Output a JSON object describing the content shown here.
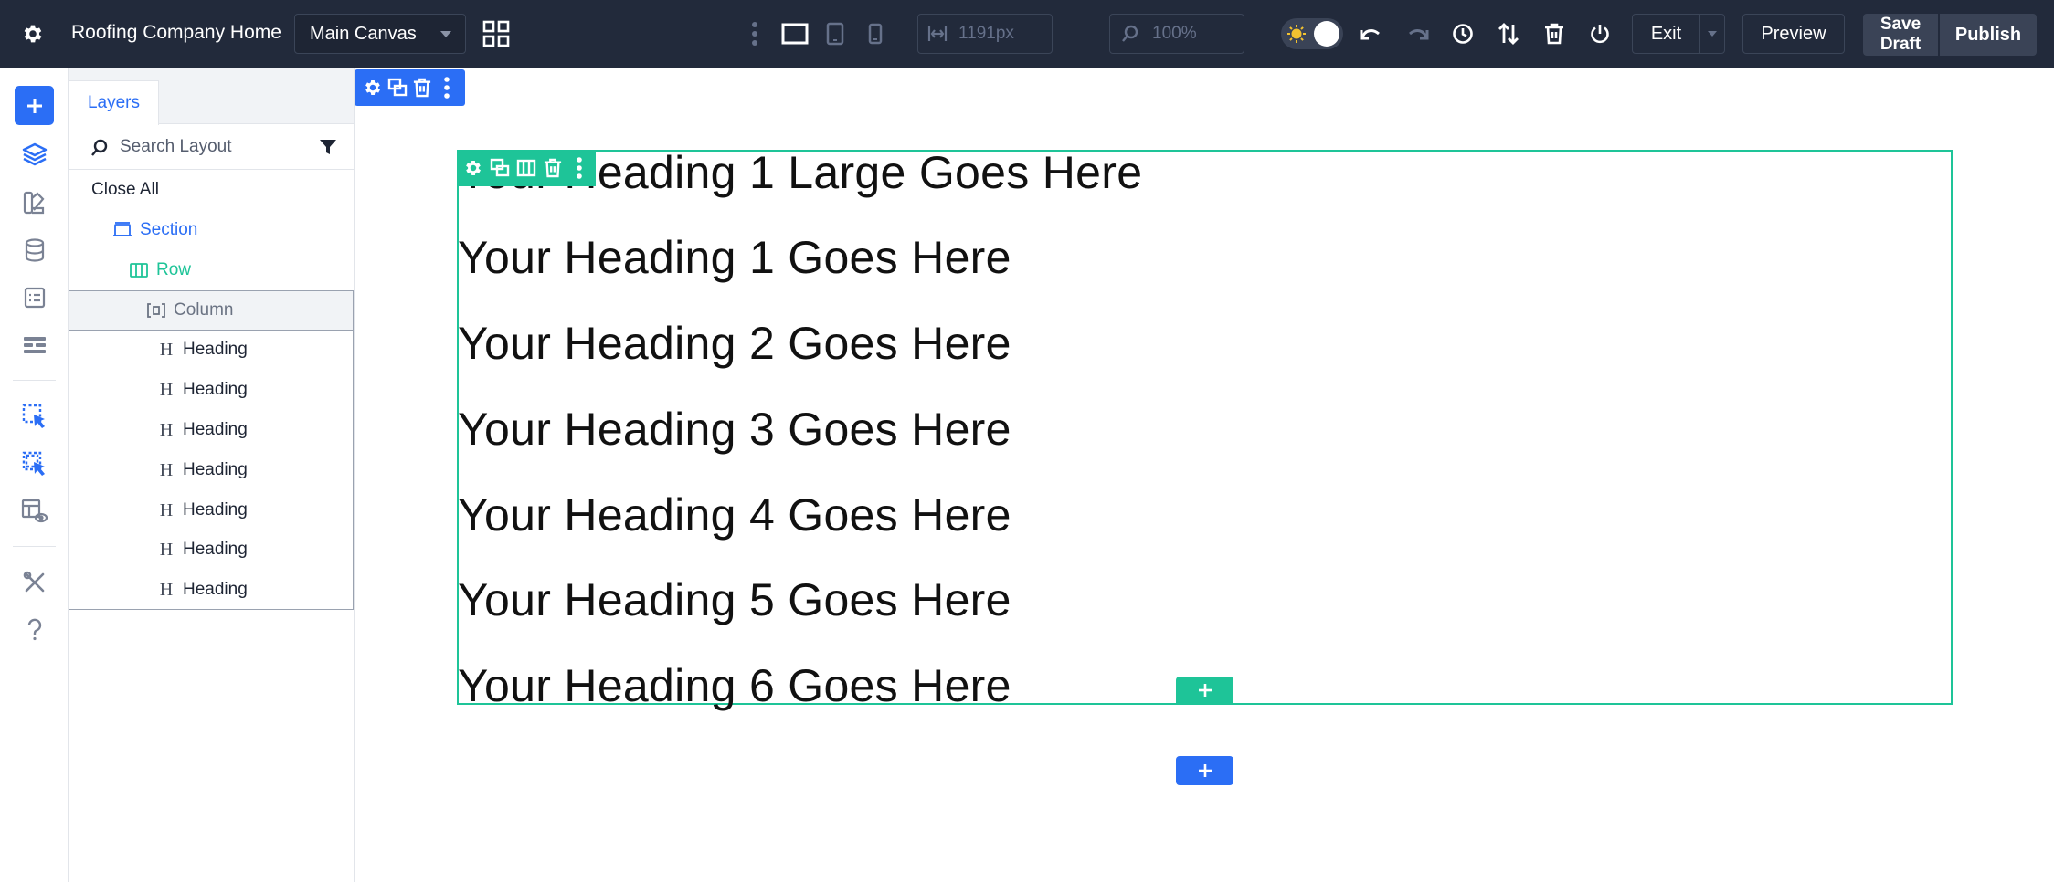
{
  "topbar": {
    "site_title": "Roofing Company Home",
    "canvas_select": "Main Canvas",
    "width_value": "1191px",
    "zoom_value": "100%",
    "exit_label": "Exit",
    "preview_label": "Preview",
    "save_draft_line1": "Save",
    "save_draft_line2": "Draft",
    "publish_label": "Publish"
  },
  "layers": {
    "tab_label": "Layers",
    "search_placeholder": "Search Layout",
    "close_all_label": "Close All",
    "section_label": "Section",
    "row_label": "Row",
    "column_label": "Column",
    "headings": [
      "Heading",
      "Heading",
      "Heading",
      "Heading",
      "Heading",
      "Heading",
      "Heading"
    ]
  },
  "canvas": {
    "headings": [
      "Your Heading 1 Large Goes Here",
      "Your Heading 1 Goes Here",
      "Your Heading 2 Goes Here",
      "Your Heading 3 Goes Here",
      "Your Heading 4 Goes Here",
      "Your Heading 5 Goes Here",
      "Your Heading 6 Goes Here"
    ]
  },
  "colors": {
    "topbar_bg": "#222a3b",
    "accent_blue": "#2b6ef5",
    "accent_green": "#1ec498"
  }
}
